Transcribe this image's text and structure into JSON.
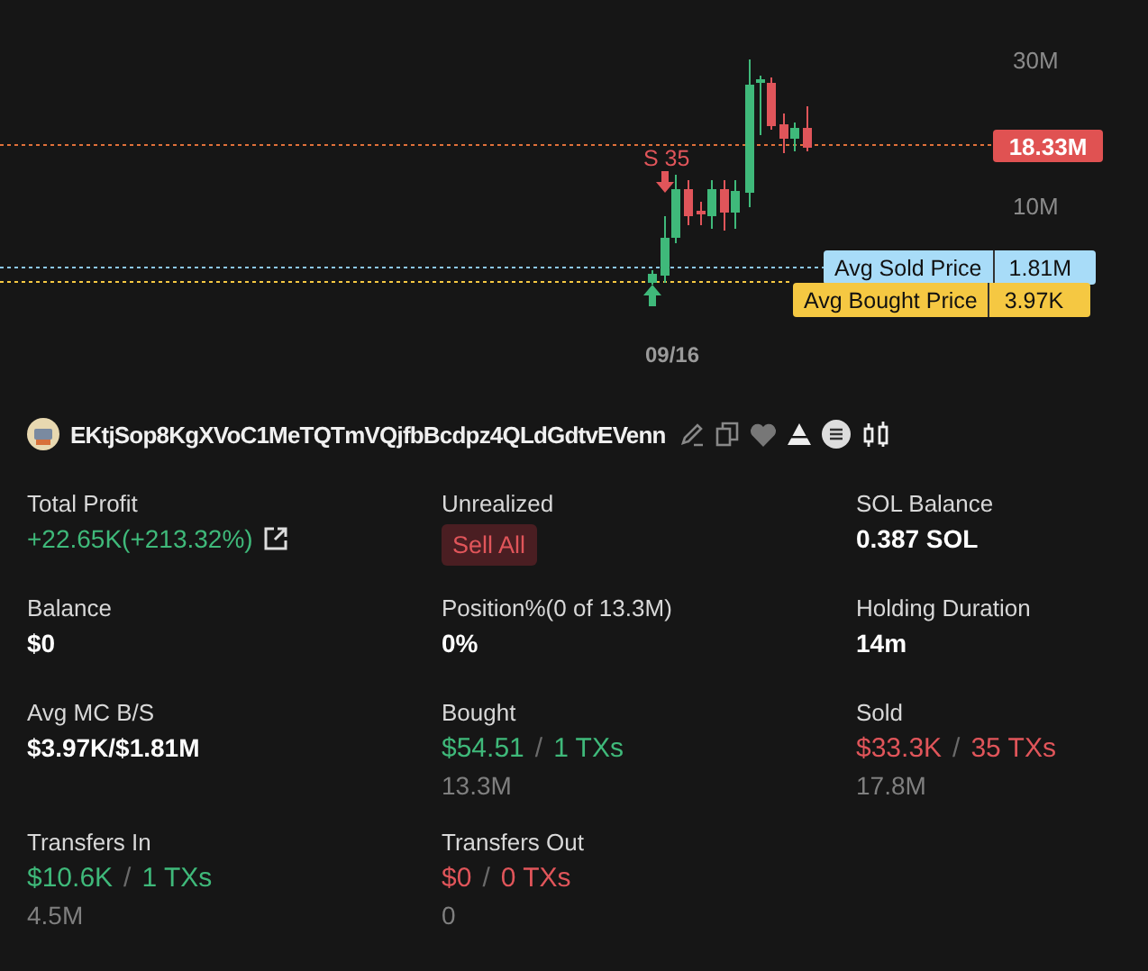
{
  "chart": {
    "axis_labels": [
      "30M",
      "10M"
    ],
    "price_tag": "18.33M",
    "sell_marker": "S 35",
    "date_label": "09/16",
    "avg_lines": [
      {
        "kind": "sold",
        "label": "Avg Sold Price",
        "value": "1.81M"
      },
      {
        "kind": "bought",
        "label": "Avg Bought Price",
        "value": "3.97K"
      }
    ]
  },
  "wallet": {
    "address": "EKtjSop8KgXVoC1MeTQTmVQjfbBcdpz4QLdGdtvEVenn"
  },
  "stats": [
    {
      "kind": "profit",
      "label": "Total Profit",
      "value": "+22.65K(+213.32%)"
    },
    {
      "kind": "button",
      "label": "Unrealized",
      "value": "Sell All"
    },
    {
      "kind": "plain",
      "label": "SOL Balance",
      "value": "0.387 SOL"
    },
    {
      "kind": "plain",
      "label": "Balance",
      "value": "$0"
    },
    {
      "kind": "plain",
      "label": "Position%(0 of 13.3M)",
      "value": "0%"
    },
    {
      "kind": "plain",
      "label": "Holding Duration",
      "value": "14m"
    },
    {
      "kind": "plain",
      "label": "Avg MC B/S",
      "value": "$3.97K/$1.81M"
    },
    {
      "kind": "trade",
      "color": "#3fb97a",
      "label": "Bought",
      "amount": "$54.51",
      "separator": "/",
      "txs": "1 TXs",
      "sub": "13.3M"
    },
    {
      "kind": "trade",
      "color": "#e0555a",
      "label": "Sold",
      "amount": "$33.3K",
      "separator": "/",
      "txs": "35 TXs",
      "sub": "17.8M"
    },
    {
      "kind": "trade",
      "color": "#3fb97a",
      "label": "Transfers In",
      "amount": "$10.6K",
      "separator": "/",
      "txs": "1 TXs",
      "sub": "4.5M"
    },
    {
      "kind": "trade",
      "color": "#e0555a",
      "label": "Transfers Out",
      "amount": "$0",
      "separator": "/",
      "txs": "0 TXs",
      "sub": "0"
    }
  ]
}
